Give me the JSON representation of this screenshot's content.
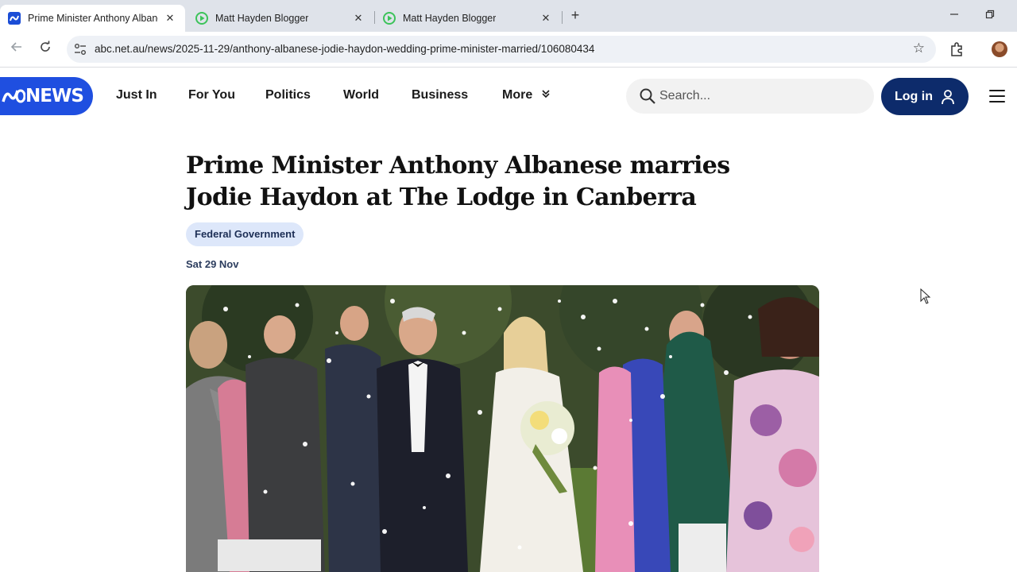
{
  "browser": {
    "tabs": [
      {
        "title": "Prime Minister Anthony Albane",
        "favicon": "abc-icon",
        "active": true
      },
      {
        "title": "Matt Hayden Blogger",
        "favicon": "play-icon",
        "active": false
      },
      {
        "title": "Matt Hayden Blogger",
        "favicon": "play-icon",
        "active": false
      }
    ],
    "close_glyph": "✕",
    "new_tab_glyph": "+",
    "url": "abc.net.au/news/2025-11-29/anthony-albanese-jodie-haydon-wedding-prime-minister-married/106080434"
  },
  "site": {
    "logo_text": "NEWS",
    "nav": [
      "Just In",
      "For You",
      "Politics",
      "World",
      "Business",
      "More"
    ],
    "search_placeholder": "Search...",
    "login_label": "Log in",
    "brand_color": "#1f4fe0",
    "login_color": "#0d2b6b"
  },
  "article": {
    "headline": "Prime Minister Anthony Albanese marries Jodie Haydon at The Lodge in Canberra",
    "topic": "Federal Government",
    "date": "Sat 29 Nov",
    "image_description_icon": "wedding-photo"
  }
}
